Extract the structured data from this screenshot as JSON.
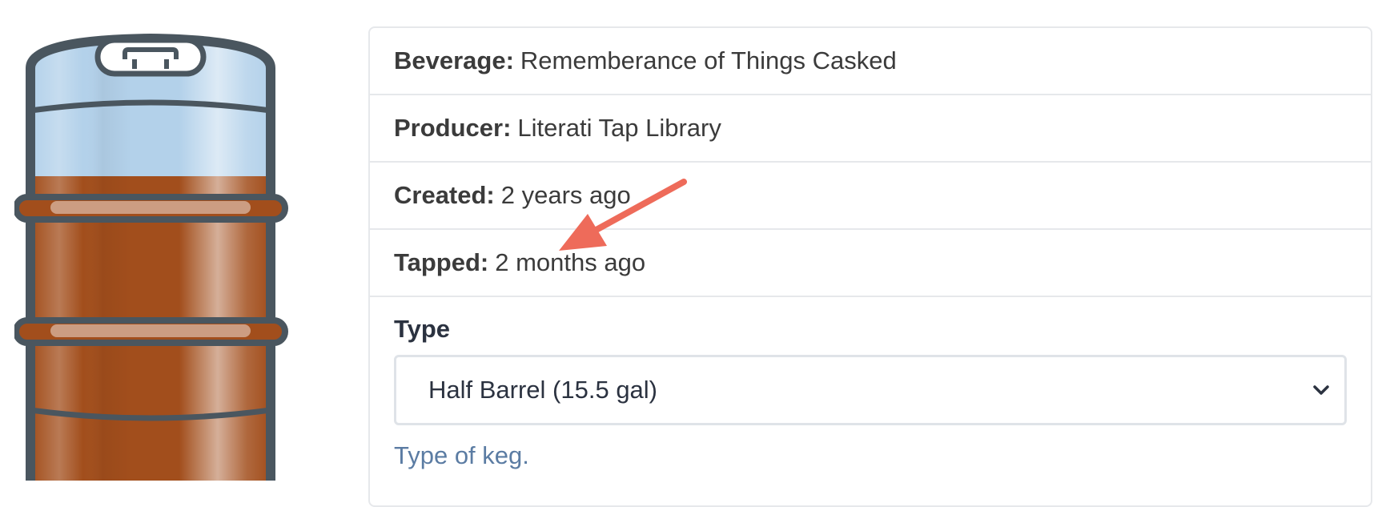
{
  "details": {
    "beverage_label": "Beverage:",
    "beverage_value": "Rememberance of Things Casked",
    "producer_label": "Producer:",
    "producer_value": "Literati Tap Library",
    "created_label": "Created:",
    "created_value": "2 years ago",
    "tapped_label": "Tapped:",
    "tapped_value": "2 months ago"
  },
  "form": {
    "type_label": "Type",
    "type_selected": "Half Barrel (15.5 gal)",
    "type_help": "Type of keg."
  },
  "keg": {
    "icon": "keg-icon",
    "liquid_color": "#a24e1c",
    "empty_color": "#b3d1ea",
    "outline_color": "#4a565f"
  },
  "annotation": {
    "arrow_color": "#ee6b5a"
  }
}
